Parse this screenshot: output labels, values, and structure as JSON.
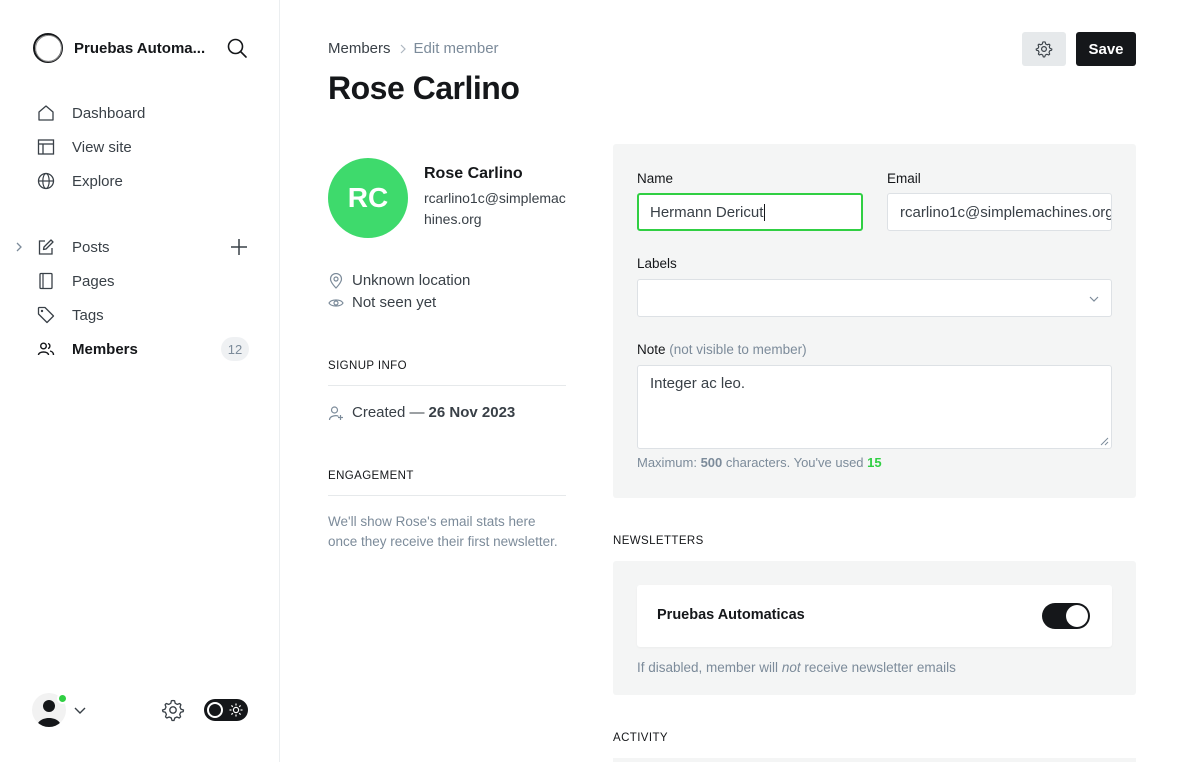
{
  "sidebar": {
    "site_title": "Pruebas Automa...",
    "nav": [
      {
        "label": "Dashboard",
        "icon": "house-icon"
      },
      {
        "label": "View site",
        "icon": "layout-icon"
      },
      {
        "label": "Explore",
        "icon": "globe-icon"
      },
      {
        "label": "Posts",
        "icon": "pen-icon"
      },
      {
        "label": "Pages",
        "icon": "page-icon"
      },
      {
        "label": "Tags",
        "icon": "tag-icon"
      },
      {
        "label": "Members",
        "icon": "users-icon",
        "active": true,
        "count": "12"
      }
    ]
  },
  "header": {
    "breadcrumb_parent": "Members",
    "breadcrumb_current": "Edit member",
    "title": "Rose Carlino",
    "save_label": "Save"
  },
  "member": {
    "initials": "RC",
    "name": "Rose Carlino",
    "email": "rcarlino1c@simplemachines.org",
    "location": "Unknown location",
    "seen": "Not seen yet",
    "signup_heading": "SIGNUP INFO",
    "created_label": "Created —",
    "created_date": "26 Nov 2023",
    "engagement_heading": "ENGAGEMENT",
    "engagement_text": "We'll show Rose's email stats here once they receive their first newsletter."
  },
  "form": {
    "name_label": "Name",
    "name_value": "Hermann Dericut",
    "email_label": "Email",
    "email_value": "rcarlino1c@simplemachines.org",
    "labels_label": "Labels",
    "note_label": "Note",
    "note_hint": "(not visible to member)",
    "note_value": "Integer ac leo.",
    "char_prefix": "Maximum:",
    "char_max": "500",
    "char_mid": "characters. You've used",
    "char_used": "15"
  },
  "newsletters": {
    "heading": "NEWSLETTERS",
    "name": "Pruebas Automaticas",
    "subscribed": true,
    "hint_pre": "If disabled, member will",
    "hint_em": "not",
    "hint_post": "receive newsletter emails"
  },
  "activity": {
    "heading": "ACTIVITY"
  },
  "colors": {
    "accent_green": "#30cf43",
    "avatar_green": "#3eda6c",
    "dark": "#15171a"
  }
}
